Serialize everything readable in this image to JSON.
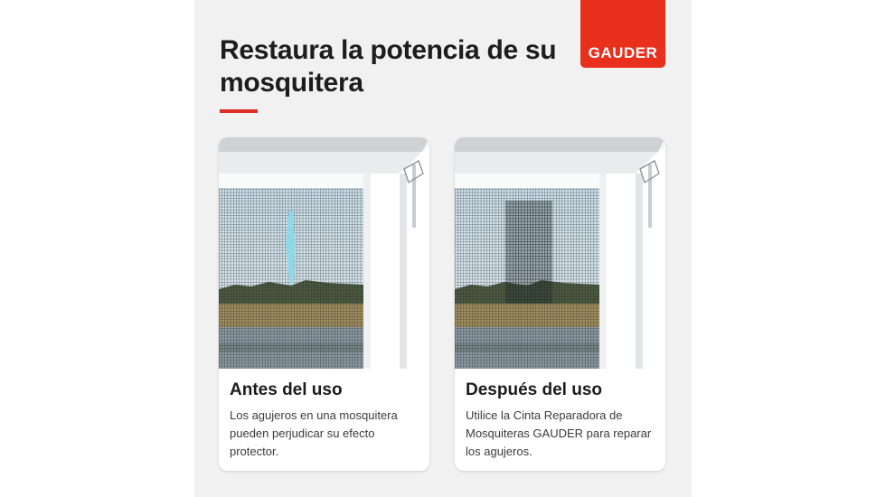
{
  "brand": {
    "logo_text": "GAUDER",
    "color": "#e8301d"
  },
  "header": {
    "title": "Restaura la potencia de su mosquitera",
    "accent_color": "#dc2f25"
  },
  "cards": [
    {
      "title": "Antes del uso",
      "body": "Los agujeros en una mosquitera pueden perjudicar su efecto protector.",
      "image": "mosquito-screen-with-hole"
    },
    {
      "title": "Después del uso",
      "body": "Utilice la Cinta Reparadora de Mosquiteras GAUDER para reparar los agujeros.",
      "image": "mosquito-screen-repaired"
    }
  ]
}
